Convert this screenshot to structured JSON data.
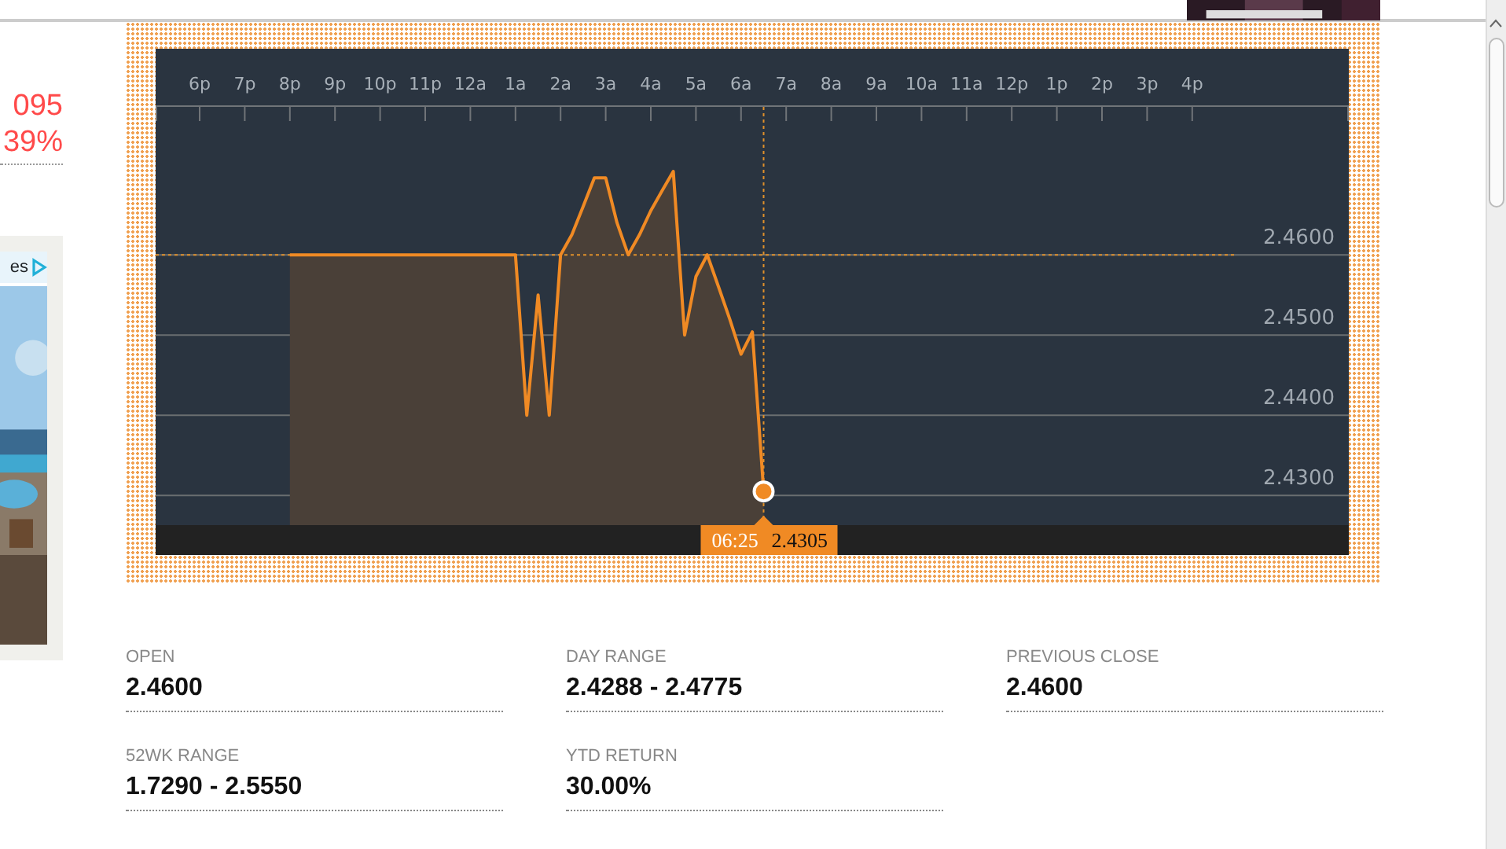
{
  "left_panel": {
    "change": "095",
    "change_percent": "39%",
    "ad": {
      "label": "es",
      "kind": "picture"
    }
  },
  "chart": {
    "chart_data": {
      "type": "area",
      "categories": [
        "6p",
        null,
        null,
        null,
        "7p",
        null,
        null,
        null,
        "8p",
        null,
        null,
        null,
        "9p",
        null,
        null,
        null,
        "10p",
        null,
        null,
        null,
        "11p",
        null,
        null,
        null,
        "12a",
        null,
        null,
        null,
        "1a",
        null,
        null,
        null,
        "2a",
        null,
        null,
        null,
        "3a",
        null,
        null,
        null,
        "4a",
        null,
        null,
        null,
        "5a",
        null,
        null,
        null,
        "6a",
        null,
        null,
        null,
        "7a",
        null,
        null,
        null,
        "8a",
        null,
        null,
        null,
        "9a",
        null,
        null,
        null,
        "10a",
        null,
        null,
        null,
        "11a",
        null,
        null,
        null,
        "12p",
        null,
        null,
        null,
        "1p",
        null,
        null,
        null,
        "2p",
        null,
        null,
        null,
        "3p",
        null,
        null,
        null,
        "4p"
      ],
      "series": [
        {
          "color": "#f08a24",
          "values": [
            null,
            null,
            null,
            null,
            null,
            null,
            null,
            null,
            2.46,
            2.46,
            2.46,
            2.46,
            2.46,
            2.46,
            2.46,
            2.46,
            2.46,
            2.46,
            2.46,
            2.46,
            2.46,
            2.46,
            2.46,
            2.46,
            2.46,
            2.46,
            2.46,
            2.46,
            2.46,
            2.44,
            2.455,
            2.44,
            2.46,
            2.4625,
            2.466,
            2.4696,
            2.4696,
            2.464,
            2.46,
            2.4625,
            2.4655,
            2.468,
            2.4704,
            2.45,
            2.4573,
            2.46,
            2.456,
            2.452,
            2.4476,
            2.4504,
            2.4305,
            null,
            null,
            null,
            null,
            null,
            null,
            null,
            null,
            null,
            null,
            null,
            null,
            null,
            null,
            null,
            null,
            null,
            null,
            null,
            null,
            null,
            null,
            null,
            null,
            null,
            null,
            null,
            null,
            null,
            null,
            null,
            null,
            null,
            null,
            null,
            null,
            null,
            null
          ]
        }
      ],
      "yticks": [
        {
          "value": 2.46,
          "label": "2.4600"
        },
        {
          "value": 2.45,
          "label": "2.4500"
        },
        {
          "value": 2.44,
          "label": "2.4400"
        },
        {
          "value": 2.43,
          "label": "2.4300"
        }
      ],
      "ylim": [
        2.4263,
        2.4857
      ],
      "grid": true
    },
    "tooltip": {
      "time": "06:25",
      "value": "2.4305"
    }
  },
  "stats": [
    {
      "label": "OPEN",
      "value": "2.4600"
    },
    {
      "label": "DAY RANGE",
      "value": "2.4288 - 2.4775"
    },
    {
      "label": "PREVIOUS CLOSE",
      "value": "2.4600"
    },
    {
      "label": "52WK RANGE",
      "value": "1.7290 - 2.5550"
    },
    {
      "label": "YTD RETURN",
      "value": "30.00%"
    }
  ]
}
